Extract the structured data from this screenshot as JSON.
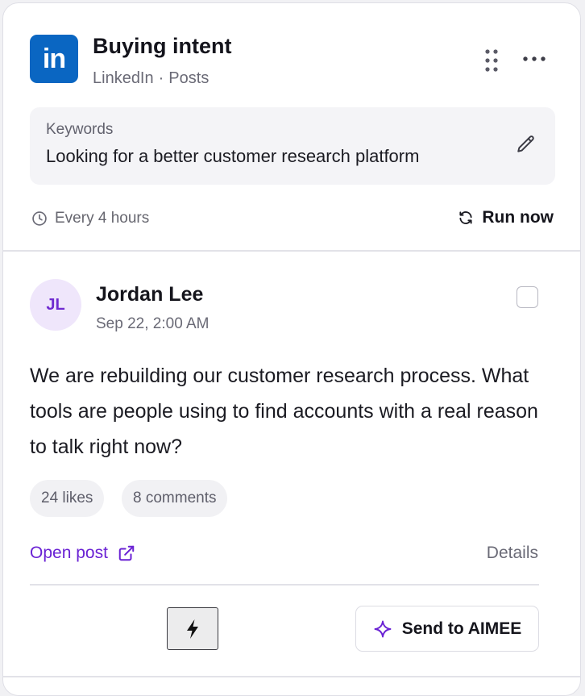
{
  "source": {
    "logo_text": "in",
    "title": "Buying intent",
    "platform": "LinkedIn",
    "separator": "·",
    "content_type": "Posts",
    "brand_color": "#0a66c2"
  },
  "keywords": {
    "label": "Keywords",
    "value": "Looking for a better customer research platform"
  },
  "schedule": {
    "frequency": "Every 4 hours",
    "run_now_label": "Run now"
  },
  "post": {
    "author_initials": "JL",
    "author_name": "Jordan Lee",
    "date": "Sep 22, 2:00 AM",
    "body": "We are rebuilding our customer research process. What tools are people using to find accounts with a real reason to talk right now?",
    "likes": "24 likes",
    "comments": "8 comments",
    "selected": false,
    "open_post_label": "Open post",
    "details_label": "Details"
  },
  "actions": {
    "quick_action_icon": "lightning-bolt-icon",
    "send_label": "Send to AIMEE",
    "send_icon": "sparkle-icon"
  },
  "colors": {
    "accent": "#6a22d4",
    "avatar_bg": "#efe6fb"
  }
}
